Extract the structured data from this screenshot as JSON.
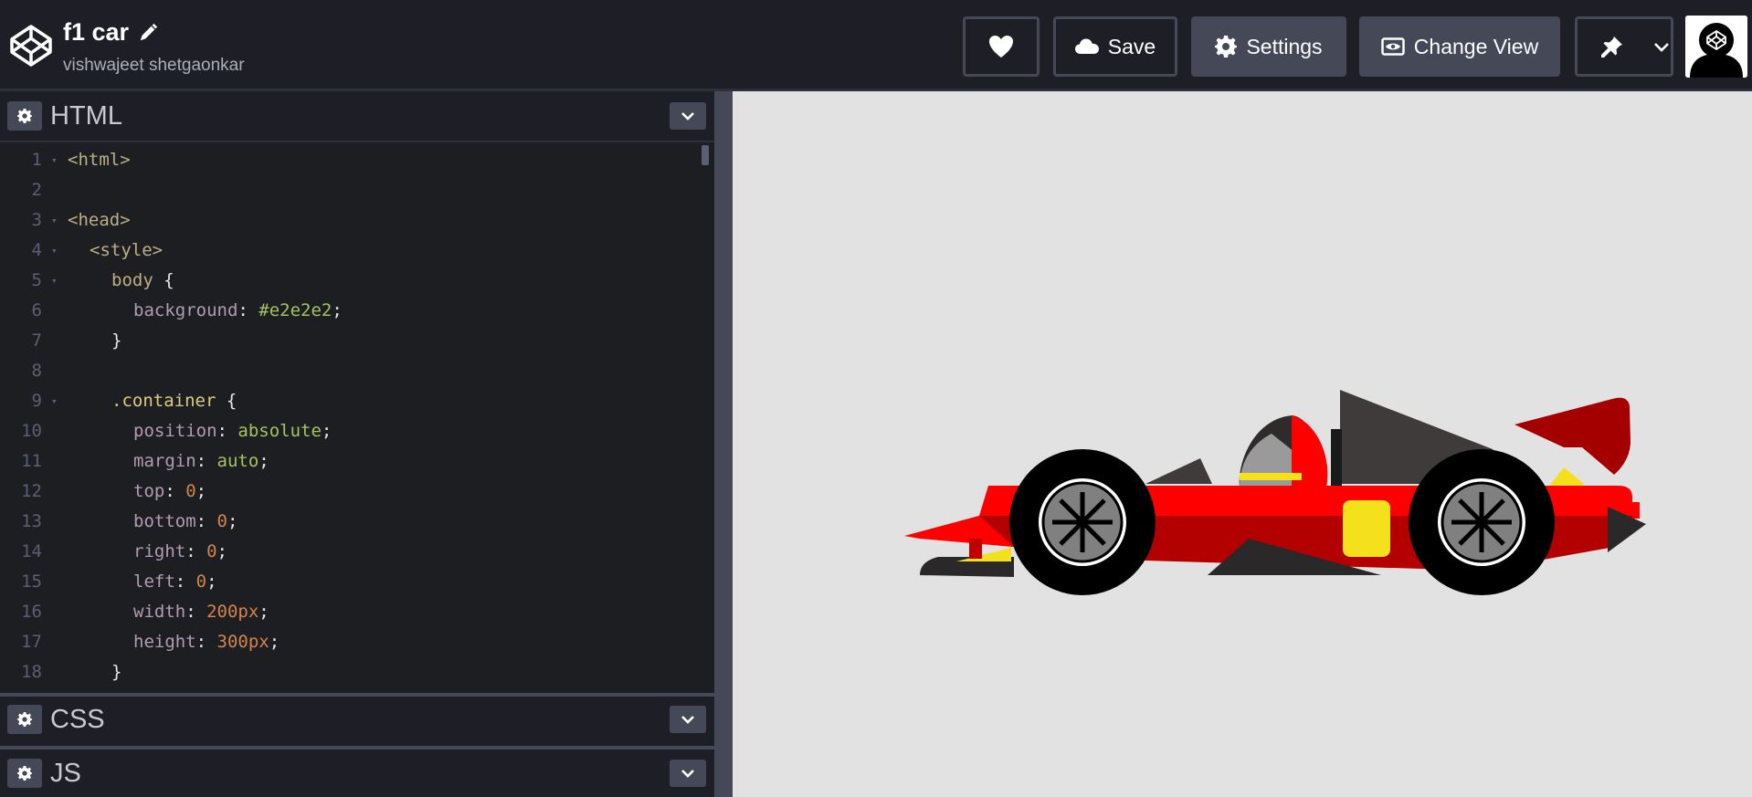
{
  "header": {
    "title": "f1 car",
    "author": "vishwajeet shetgaonkar",
    "buttons": {
      "save": "Save",
      "settings": "Settings",
      "change_view": "Change View"
    }
  },
  "panels": {
    "html": "HTML",
    "css": "CSS",
    "js": "JS"
  },
  "code_lines": [
    {
      "n": "1",
      "fold": true,
      "indent": 0,
      "tokens": [
        [
          "t-tag",
          "<html>"
        ]
      ]
    },
    {
      "n": "2",
      "fold": false,
      "indent": 0,
      "tokens": []
    },
    {
      "n": "3",
      "fold": true,
      "indent": 0,
      "tokens": [
        [
          "t-tag",
          "<head>"
        ]
      ]
    },
    {
      "n": "4",
      "fold": true,
      "indent": 1,
      "tokens": [
        [
          "t-tag",
          "<style>"
        ]
      ]
    },
    {
      "n": "5",
      "fold": true,
      "indent": 2,
      "tokens": [
        [
          "t-tag",
          "body"
        ],
        [
          "t-pun",
          " {"
        ]
      ]
    },
    {
      "n": "6",
      "fold": false,
      "indent": 3,
      "tokens": [
        [
          "t-prop",
          "background"
        ],
        [
          "t-pun",
          ": "
        ],
        [
          "t-val",
          "#e2e2e2"
        ],
        [
          "t-pun",
          ";"
        ]
      ]
    },
    {
      "n": "7",
      "fold": false,
      "indent": 2,
      "tokens": [
        [
          "t-pun",
          "}"
        ]
      ]
    },
    {
      "n": "8",
      "fold": false,
      "indent": 0,
      "tokens": []
    },
    {
      "n": "9",
      "fold": true,
      "indent": 2,
      "tokens": [
        [
          "t-sel",
          ".container"
        ],
        [
          "t-pun",
          " {"
        ]
      ]
    },
    {
      "n": "10",
      "fold": false,
      "indent": 3,
      "tokens": [
        [
          "t-prop",
          "position"
        ],
        [
          "t-pun",
          ": "
        ],
        [
          "t-val",
          "absolute"
        ],
        [
          "t-pun",
          ";"
        ]
      ]
    },
    {
      "n": "11",
      "fold": false,
      "indent": 3,
      "tokens": [
        [
          "t-prop",
          "margin"
        ],
        [
          "t-pun",
          ": "
        ],
        [
          "t-val",
          "auto"
        ],
        [
          "t-pun",
          ";"
        ]
      ]
    },
    {
      "n": "12",
      "fold": false,
      "indent": 3,
      "tokens": [
        [
          "t-prop",
          "top"
        ],
        [
          "t-pun",
          ": "
        ],
        [
          "t-num",
          "0"
        ],
        [
          "t-pun",
          ";"
        ]
      ]
    },
    {
      "n": "13",
      "fold": false,
      "indent": 3,
      "tokens": [
        [
          "t-prop",
          "bottom"
        ],
        [
          "t-pun",
          ": "
        ],
        [
          "t-num",
          "0"
        ],
        [
          "t-pun",
          ";"
        ]
      ]
    },
    {
      "n": "14",
      "fold": false,
      "indent": 3,
      "tokens": [
        [
          "t-prop",
          "right"
        ],
        [
          "t-pun",
          ": "
        ],
        [
          "t-num",
          "0"
        ],
        [
          "t-pun",
          ";"
        ]
      ]
    },
    {
      "n": "15",
      "fold": false,
      "indent": 3,
      "tokens": [
        [
          "t-prop",
          "left"
        ],
        [
          "t-pun",
          ": "
        ],
        [
          "t-num",
          "0"
        ],
        [
          "t-pun",
          ";"
        ]
      ]
    },
    {
      "n": "16",
      "fold": false,
      "indent": 3,
      "tokens": [
        [
          "t-prop",
          "width"
        ],
        [
          "t-pun",
          ": "
        ],
        [
          "t-num",
          "200px"
        ],
        [
          "t-pun",
          ";"
        ]
      ]
    },
    {
      "n": "17",
      "fold": false,
      "indent": 3,
      "tokens": [
        [
          "t-prop",
          "height"
        ],
        [
          "t-pun",
          ": "
        ],
        [
          "t-num",
          "300px"
        ],
        [
          "t-pun",
          ";"
        ]
      ]
    },
    {
      "n": "18",
      "fold": false,
      "indent": 2,
      "tokens": [
        [
          "t-pun",
          "}"
        ]
      ]
    }
  ],
  "icons": {
    "logo": "codepen-logo-icon",
    "edit": "pencil-icon",
    "heart": "heart-icon",
    "save": "cloud-icon",
    "settings": "gear-icon",
    "view": "eye-icon",
    "pin": "pin-icon",
    "dropdown": "chevron-down-icon"
  },
  "colors": {
    "preview_background": "#e2e2e2",
    "car_red": "#ff0000",
    "car_dark_red": "#b30000",
    "car_yellow": "#f5e11b",
    "car_dark": "#403b3b"
  }
}
